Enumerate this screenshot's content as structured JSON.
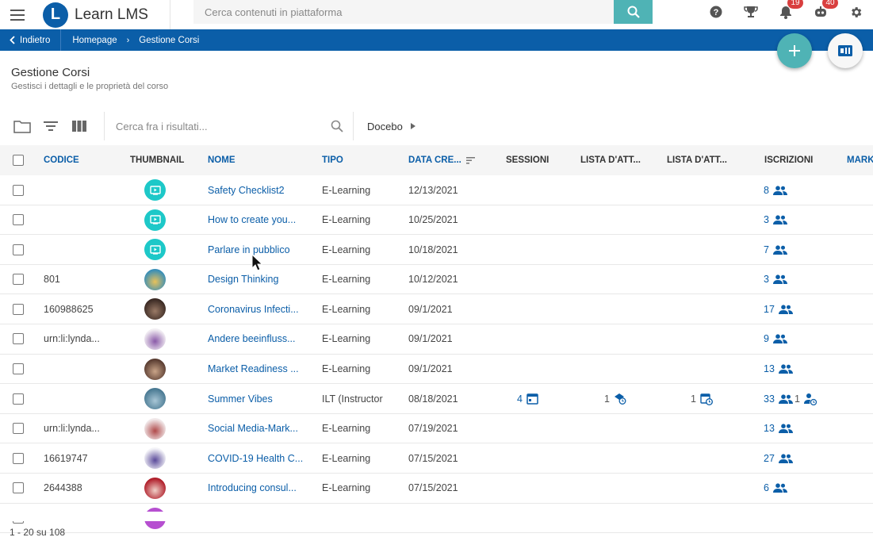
{
  "app": {
    "title": "Learn LMS",
    "logo_letter": "L"
  },
  "search": {
    "placeholder": "Cerca contenuti in piattaforma"
  },
  "header_icons": {
    "help": "help-icon",
    "trophy": "trophy-icon",
    "notifications": {
      "icon": "bell-icon",
      "count": "19"
    },
    "chat": {
      "icon": "chatbot-icon",
      "count": "40"
    },
    "settings": "gear-icon"
  },
  "breadcrumb": {
    "back_label": "Indietro",
    "items": [
      "Homepage",
      "Gestione Corsi"
    ]
  },
  "page": {
    "title": "Gestione Corsi",
    "subtitle": "Gestisci i dettagli e le proprietà del corso"
  },
  "toolbar": {
    "search_placeholder": "Cerca fra i risultati...",
    "filter_label": "Docebo"
  },
  "table": {
    "columns": [
      "CODICE",
      "THUMBNAIL",
      "NOME",
      "TIPO",
      "DATA CRE...",
      "SESSIONI",
      "LISTA D'ATT...",
      "LISTA D'ATT...",
      "ISCRIZIONI",
      "MARK"
    ],
    "rows": [
      {
        "code": "",
        "thumb": "elearning",
        "name": "Safety Checklist2",
        "type": "E-Learning",
        "date": "12/13/2021",
        "sessions": "",
        "wl1": "",
        "wl2": "",
        "enrollments": "8",
        "extra": ""
      },
      {
        "code": "",
        "thumb": "elearning",
        "name": "How to create you...",
        "type": "E-Learning",
        "date": "10/25/2021",
        "sessions": "",
        "wl1": "",
        "wl2": "",
        "enrollments": "3",
        "extra": ""
      },
      {
        "code": "",
        "thumb": "elearning",
        "name": "Parlare in pubblico",
        "type": "E-Learning",
        "date": "10/18/2021",
        "sessions": "",
        "wl1": "",
        "wl2": "",
        "enrollments": "7",
        "extra": ""
      },
      {
        "code": "801",
        "thumb": "photo-a",
        "name": "Design Thinking",
        "type": "E-Learning",
        "date": "10/12/2021",
        "sessions": "",
        "wl1": "",
        "wl2": "",
        "enrollments": "3",
        "extra": ""
      },
      {
        "code": "160988625",
        "thumb": "photo-b",
        "name": "Coronavirus Infecti...",
        "type": "E-Learning",
        "date": "09/1/2021",
        "sessions": "",
        "wl1": "",
        "wl2": "",
        "enrollments": "17",
        "extra": ""
      },
      {
        "code": "urn:li:lynda...",
        "thumb": "photo-c",
        "name": "Andere beeinfluss...",
        "type": "E-Learning",
        "date": "09/1/2021",
        "sessions": "",
        "wl1": "",
        "wl2": "",
        "enrollments": "9",
        "extra": ""
      },
      {
        "code": "",
        "thumb": "photo-d",
        "name": "Market Readiness ...",
        "type": "E-Learning",
        "date": "09/1/2021",
        "sessions": "",
        "wl1": "",
        "wl2": "",
        "enrollments": "13",
        "extra": ""
      },
      {
        "code": "",
        "thumb": "photo-e",
        "name": "Summer Vibes",
        "type": "ILT (Instructor",
        "date": "08/18/2021",
        "sessions": "4",
        "wl1": "1",
        "wl2": "1",
        "enrollments": "33",
        "extra": "1"
      },
      {
        "code": "urn:li:lynda...",
        "thumb": "photo-f",
        "name": "Social Media-Mark...",
        "type": "E-Learning",
        "date": "07/19/2021",
        "sessions": "",
        "wl1": "",
        "wl2": "",
        "enrollments": "13",
        "extra": ""
      },
      {
        "code": "16619747",
        "thumb": "photo-g",
        "name": "COVID-19 Health C...",
        "type": "E-Learning",
        "date": "07/15/2021",
        "sessions": "",
        "wl1": "",
        "wl2": "",
        "enrollments": "27",
        "extra": ""
      },
      {
        "code": "2644388",
        "thumb": "photo-h",
        "name": "Introducing consul...",
        "type": "E-Learning",
        "date": "07/15/2021",
        "sessions": "",
        "wl1": "",
        "wl2": "",
        "enrollments": "6",
        "extra": ""
      }
    ]
  },
  "pagination": {
    "label": "1 - 20 su 108"
  },
  "colors": {
    "brand": "#0b5ea8",
    "accent": "#4fb3b5",
    "badge": "#d93f3f",
    "elearning_thumb": "#1dc8c8"
  }
}
